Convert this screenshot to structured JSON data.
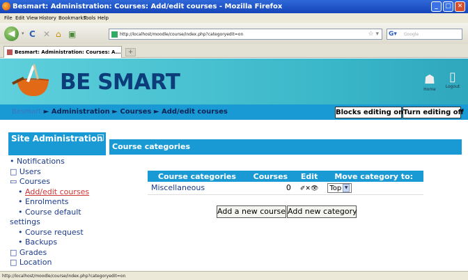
{
  "window": {
    "title": "Besmart: Administration: Courses: Add/edit courses - Mozilla Firefox",
    "minimize": "_",
    "maximize": "□",
    "close": "✕"
  },
  "menu": [
    "File",
    "Edit",
    "View",
    "History",
    "Bookmarks",
    "Tools",
    "Help"
  ],
  "toolbar": {
    "url": "http://localhost/moodle/course/index.php?categoryedit=on",
    "search_placeholder": "Google"
  },
  "tab": {
    "title": "Besmart: Administration: Courses: A..."
  },
  "header": {
    "logo_text": "BE SMART",
    "home_label": "Home",
    "logout_label": "Logout"
  },
  "breadcrumb": {
    "home": "Besmart",
    "sep": "►",
    "items": [
      "Administration",
      "Courses",
      "Add/edit courses"
    ]
  },
  "header_buttons": {
    "blocks_editing": "Blocks editing on",
    "turn_editing": "Turn editing off"
  },
  "sidebar": {
    "title": "Site Administration",
    "items": [
      {
        "icon": "•",
        "label": "Notifications"
      },
      {
        "icon": "□",
        "label": "Users"
      },
      {
        "icon": "▭",
        "label": "Courses"
      },
      {
        "icon": "•",
        "label": "Add/edit courses"
      },
      {
        "icon": "•",
        "label": "Enrolments"
      },
      {
        "icon": "•",
        "label": "Course default"
      },
      {
        "icon": "",
        "label": "settings"
      },
      {
        "icon": "•",
        "label": "Course request"
      },
      {
        "icon": "•",
        "label": "Backups"
      },
      {
        "icon": "□",
        "label": "Grades"
      },
      {
        "icon": "□",
        "label": "Location"
      }
    ]
  },
  "main": {
    "heading": "Course categories",
    "table": {
      "headers": [
        "Course categories",
        "Courses",
        "Edit",
        "Move category to:"
      ],
      "rows": [
        {
          "name": "Miscellaneous",
          "courses": "0",
          "edit": "✐✕👁",
          "move": "Top"
        }
      ]
    },
    "add_course": "Add a new course",
    "add_category": "Add new category"
  },
  "statusbar": {
    "text": "http://localhost/moodle/course/index.php?categoryedit=on"
  },
  "colors": {
    "accent": "#1a9ad4",
    "banner": "#4cc6d4",
    "logo": "#0c3d7a"
  }
}
